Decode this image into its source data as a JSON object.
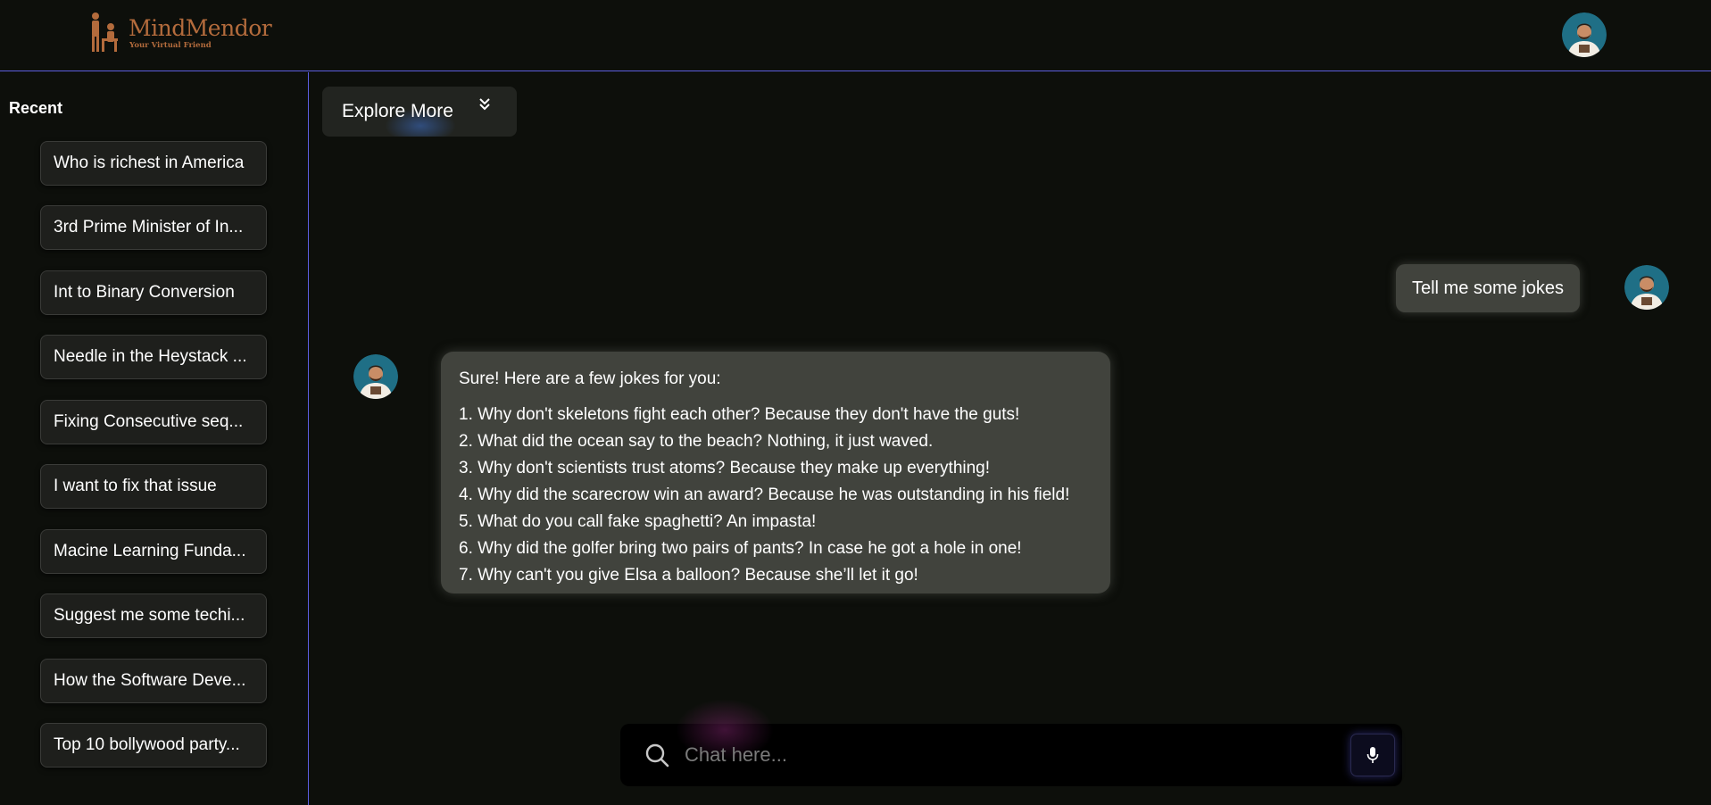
{
  "header": {
    "logo_title": "MindMendor",
    "logo_subtitle": "Your Virtual Friend",
    "brand_color": "#b36b3c",
    "accent_line_color": "#5c5ee0"
  },
  "sidebar": {
    "title": "Recent",
    "items": [
      {
        "label": "Who is richest in America"
      },
      {
        "label": "3rd Prime Minister of In..."
      },
      {
        "label": "Int to Binary Conversion"
      },
      {
        "label": "Needle in the Heystack ..."
      },
      {
        "label": "Fixing Consecutive seq..."
      },
      {
        "label": "I want to fix that issue"
      },
      {
        "label": "Macine Learning Funda..."
      },
      {
        "label": "Suggest me some techi..."
      },
      {
        "label": "How the Software Deve..."
      },
      {
        "label": "Top 10 bollywood party..."
      }
    ]
  },
  "explore": {
    "label": "Explore More",
    "icon": "double-chevron-down-icon"
  },
  "chat": {
    "user_message": "Tell me some jokes",
    "bot_intro": "Sure! Here are a few jokes for you:",
    "bot_jokes": [
      "1. Why don't skeletons fight each other? Because they don't have the guts!",
      "2. What did the ocean say to the beach? Nothing, it just waved.",
      "3. Why don't scientists trust atoms? Because they make up everything!",
      "4. Why did the scarecrow win an award? Because he was outstanding in his field!",
      "5. What do you call fake spaghetti? An impasta!",
      "6. Why did the golfer bring two pairs of pants? In case he got a hole in one!",
      "7. Why can't you give Elsa a balloon? Because she’ll let it go!"
    ]
  },
  "input": {
    "placeholder": "Chat here...",
    "value": "",
    "search_icon": "search-icon",
    "mic_icon": "microphone-icon"
  }
}
